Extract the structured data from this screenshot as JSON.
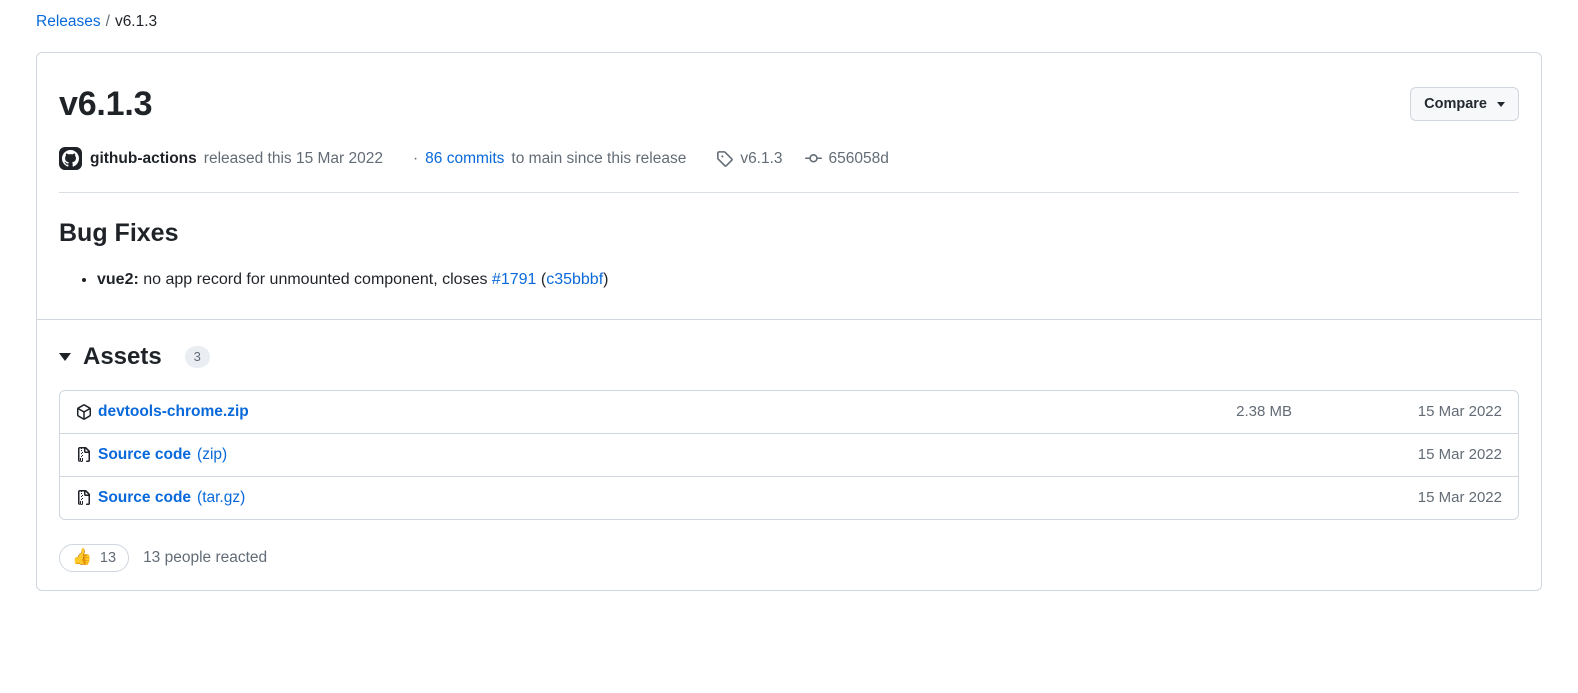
{
  "breadcrumb": {
    "releases_label": "Releases",
    "separator": "/",
    "current": "v6.1.3"
  },
  "release": {
    "title": "v6.1.3",
    "compare_label": "Compare",
    "author": "github-actions",
    "released_text": "released this 15 Mar 2022",
    "commits_prefix": "·",
    "commits_link": "86 commits",
    "commits_suffix": "to main since this release",
    "tag": "v6.1.3",
    "commit_sha": "656058d"
  },
  "body": {
    "heading": "Bug Fixes",
    "items": [
      {
        "scope": "vue2:",
        "text": "no app record for unmounted component, closes",
        "issue_link": "#1791",
        "open_paren": "(",
        "commit_link": "c35bbbf",
        "close_paren": ")"
      }
    ]
  },
  "assets": {
    "title": "Assets",
    "count": "3",
    "rows": [
      {
        "icon": "package-icon",
        "name": "devtools-chrome.zip",
        "suffix": "",
        "size": "2.38 MB",
        "date": "15 Mar 2022"
      },
      {
        "icon": "file-zip-icon",
        "name": "Source code",
        "suffix": " (zip)",
        "size": "",
        "date": "15 Mar 2022"
      },
      {
        "icon": "file-zip-icon",
        "name": "Source code",
        "suffix": " (tar.gz)",
        "size": "",
        "date": "15 Mar 2022"
      }
    ]
  },
  "reactions": {
    "emoji": "👍",
    "count": "13",
    "summary": "13 people reacted"
  },
  "colors": {
    "link": "#0969da",
    "text": "#1f2328",
    "muted": "#636c76",
    "border": "#d0d7de",
    "badge_bg": "#eaeef2",
    "button_bg": "#f6f8fa"
  }
}
